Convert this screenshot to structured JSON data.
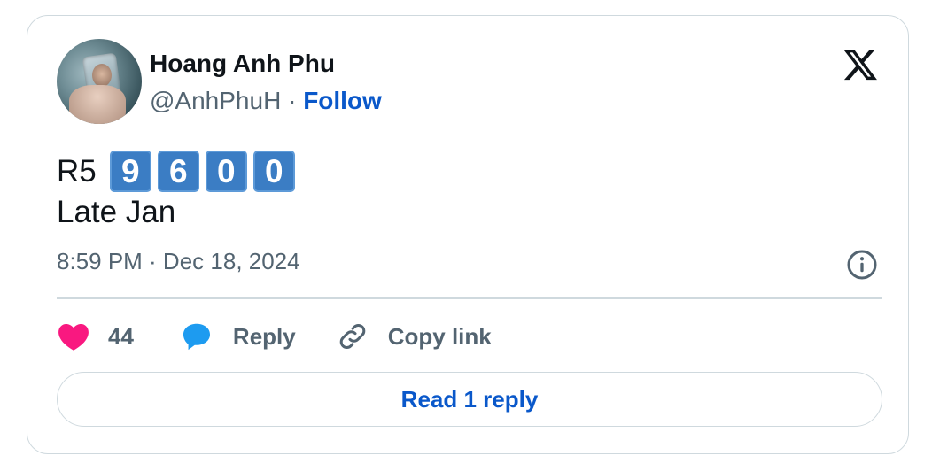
{
  "author": {
    "name": "Hoang Anh Phu",
    "handle": "@AnhPhuH",
    "separator": "·",
    "follow_label": "Follow"
  },
  "tweet": {
    "prefix": "R5",
    "digits": [
      "9",
      "6",
      "0",
      "0"
    ],
    "line2": "Late Jan",
    "timestamp": "8:59 PM · Dec 18, 2024"
  },
  "actions": {
    "like_count": "44",
    "reply_label": "Reply",
    "copy_label": "Copy link"
  },
  "read_replies_label": "Read 1 reply",
  "icons": {
    "logo": "x-logo-icon",
    "like": "heart-icon",
    "reply": "speech-bubble-icon",
    "copy": "link-icon",
    "info": "info-icon"
  },
  "colors": {
    "heart": "#f91880",
    "reply_bubble": "#1d9bf0",
    "link": "#0a58ca",
    "digit_bg": "#3b7dc4"
  }
}
